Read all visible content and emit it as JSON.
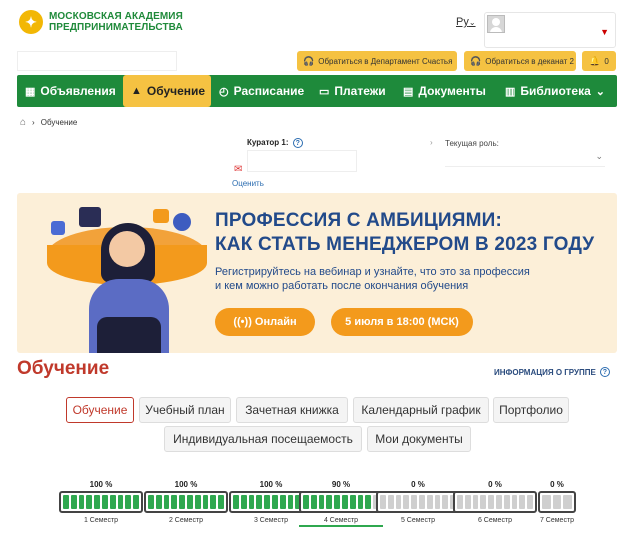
{
  "brand": {
    "line1": "МОСКОВСКАЯ АКАДЕМИЯ",
    "line2": "ПРЕДПРИНИМАТЕЛЬСТВА"
  },
  "header": {
    "language": "Ру",
    "notifications_count": "0"
  },
  "quick_links": {
    "happiness": "Обратиться в Департамент Счастья",
    "dean": "Обратиться в деканат 2"
  },
  "nav": [
    {
      "label": "Объявления",
      "icon": "▦"
    },
    {
      "label": "Обучение",
      "icon": "▲"
    },
    {
      "label": "Расписание",
      "icon": "◴"
    },
    {
      "label": "Платежи",
      "icon": "▭"
    },
    {
      "label": "Документы",
      "icon": "▤"
    },
    {
      "label": "Библиотека",
      "icon": "▥",
      "caret": "⌄"
    }
  ],
  "breadcrumb": {
    "current": "Обучение"
  },
  "curator": {
    "label": "Куратор 1:",
    "rate_link": "Оценить"
  },
  "role": {
    "label": "Текущая роль:"
  },
  "banner": {
    "title_line1": "ПРОФЕССИЯ С АМБИЦИЯМИ:",
    "title_line2": "КАК СТАТЬ МЕНЕДЖЕРОМ В 2023 ГОДУ",
    "subtitle_line1": "Регистрируйтесь на вебинар и узнайте, что это за профессия",
    "subtitle_line2": "и кем можно работать после окончания обучения",
    "online_button": "((•)) Онлайн",
    "date_button": "5 июля в 18:00 (МСК)"
  },
  "section": {
    "title": "Обучение",
    "group_info": "ИНФОРМАЦИЯ О ГРУППЕ"
  },
  "tabs": [
    {
      "label": "Обучение",
      "active": true
    },
    {
      "label": "Учебный план"
    },
    {
      "label": "Зачетная книжка"
    },
    {
      "label": "Календарный график"
    },
    {
      "label": "Портфолио"
    },
    {
      "label": "Индивидуальная посещаемость"
    },
    {
      "label": "Мои документы"
    }
  ],
  "semesters": [
    {
      "label": "1 Семестр",
      "percent": "100 %",
      "progress": 1.0
    },
    {
      "label": "2 Семестр",
      "percent": "100 %",
      "progress": 1.0
    },
    {
      "label": "3 Семестр",
      "percent": "100 %",
      "progress": 1.0
    },
    {
      "label": "4 Семестр",
      "percent": "90 %",
      "progress": 0.9,
      "current": true
    },
    {
      "label": "5 Семестр",
      "percent": "0 %",
      "progress": 0
    },
    {
      "label": "6 Семестр",
      "percent": "0 %",
      "progress": 0
    },
    {
      "label": "7 Семестр",
      "percent": "0 %",
      "progress": 0
    }
  ],
  "colors": {
    "green": "#1e8a3b",
    "yellow": "#f5c242",
    "accent_red": "#c0392b",
    "banner_bg": "#fcefd8",
    "banner_text": "#224a8a",
    "orange": "#f39a1c"
  }
}
